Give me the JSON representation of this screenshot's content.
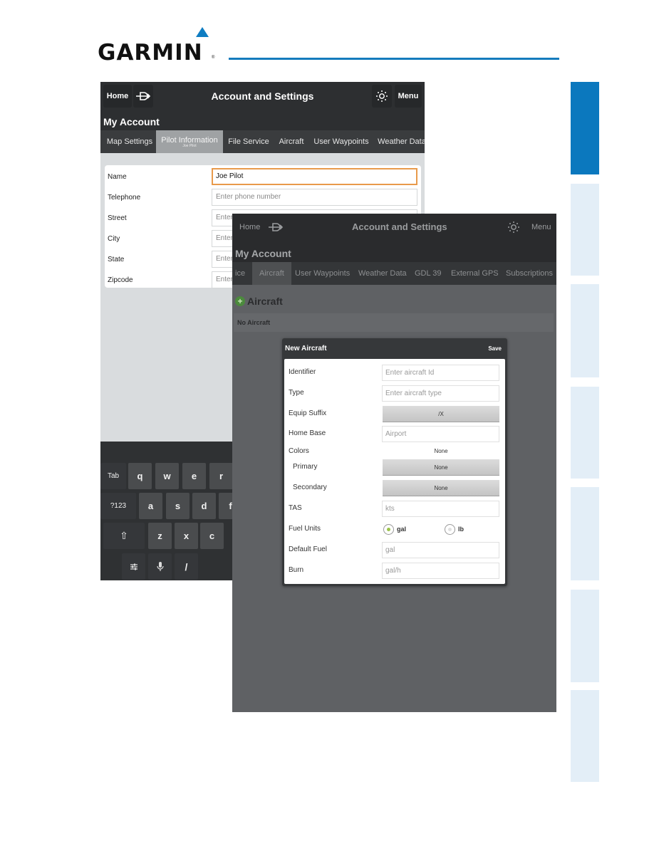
{
  "manual": {
    "brand": "GARMIN",
    "registered_mark": "®",
    "accent_color": "#0b78be",
    "side_tabs": [
      {
        "state": "active"
      },
      {
        "state": "inactive"
      },
      {
        "state": "inactive"
      },
      {
        "state": "inactive"
      },
      {
        "state": "inactive"
      },
      {
        "state": "inactive"
      },
      {
        "state": "inactive"
      }
    ]
  },
  "screen1": {
    "header": {
      "home": "Home",
      "title": "Account and Settings",
      "menu": "Menu",
      "brightness_icon": "sun-icon",
      "flightplan_icon": "flight-plan-icon"
    },
    "section_title": "My Account",
    "tabs": [
      {
        "label": "Map Settings"
      },
      {
        "label": "Pilot Information",
        "sublabel": "Joe Pilot",
        "selected": true
      },
      {
        "label": "File Service"
      },
      {
        "label": "Aircraft"
      },
      {
        "label": "User Waypoints"
      },
      {
        "label": "Weather Data"
      }
    ],
    "form": [
      {
        "label": "Name",
        "value": "Joe Pilot",
        "placeholder": "",
        "focused": true
      },
      {
        "label": "Telephone",
        "value": "",
        "placeholder": "Enter phone number"
      },
      {
        "label": "Street",
        "value": "",
        "placeholder": "Enter"
      },
      {
        "label": "City",
        "value": "",
        "placeholder": "Enter"
      },
      {
        "label": "State",
        "value": "",
        "placeholder": "Enter"
      },
      {
        "label": "Zipcode",
        "value": "",
        "placeholder": "Enter"
      }
    ],
    "keyboard": {
      "row1": [
        "Tab",
        "q",
        "w",
        "e",
        "r"
      ],
      "row2": [
        "?123",
        "a",
        "s",
        "d",
        "f"
      ],
      "row3": [
        "⇧",
        "z",
        "x",
        "c"
      ],
      "row4": [
        "settings",
        "mic",
        "/"
      ]
    }
  },
  "screen2": {
    "header": {
      "home": "Home",
      "title": "Account and Settings",
      "menu": "Menu"
    },
    "section_title": "My Account",
    "tabs": [
      {
        "label": "ice"
      },
      {
        "label": "Aircraft",
        "selected": true
      },
      {
        "label": "User Waypoints"
      },
      {
        "label": "Weather Data"
      },
      {
        "label": "GDL 39"
      },
      {
        "label": "External GPS"
      },
      {
        "label": "Subscriptions"
      }
    ],
    "aircraft_heading": "Aircraft",
    "no_aircraft": "No Aircraft",
    "dialog": {
      "title": "New Aircraft",
      "save": "Save",
      "identifier": {
        "label": "Identifier",
        "placeholder": "Enter aircraft Id"
      },
      "type": {
        "label": "Type",
        "placeholder": "Enter aircraft type"
      },
      "equip_suffix": {
        "label": "Equip Suffix",
        "value": "/X"
      },
      "home_base": {
        "label": "Home Base",
        "placeholder": "Airport"
      },
      "colors": {
        "label": "Colors",
        "value": "None"
      },
      "primary": {
        "label": "Primary",
        "value": "None"
      },
      "secondary": {
        "label": "Secondary",
        "value": "None"
      },
      "tas": {
        "label": "TAS",
        "placeholder": "kts"
      },
      "fuel_units": {
        "label": "Fuel Units",
        "options": [
          "gal",
          "lb"
        ],
        "selected": "gal"
      },
      "default_fuel": {
        "label": "Default Fuel",
        "placeholder": "gal"
      },
      "burn": {
        "label": "Burn",
        "placeholder": "gal/h"
      }
    }
  }
}
